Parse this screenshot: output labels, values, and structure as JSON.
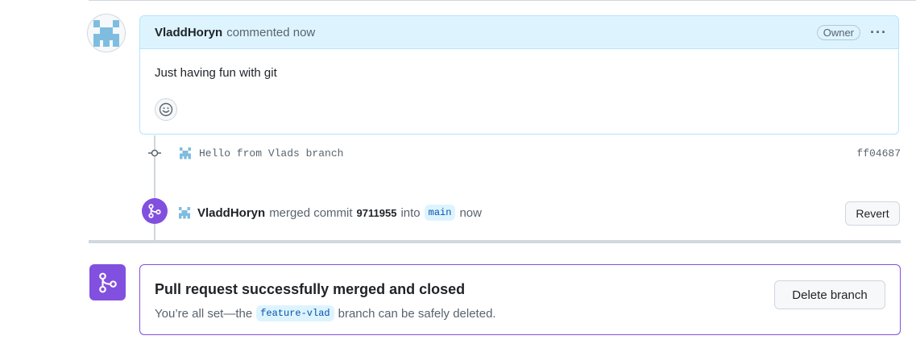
{
  "comment": {
    "author": "VladdHoryn",
    "action": "commented now",
    "role_badge": "Owner",
    "body": "Just having fun with git"
  },
  "commit": {
    "message": "Hello from Vlads branch",
    "sha": "ff04687"
  },
  "merge_event": {
    "author": "VladdHoryn",
    "action": "merged commit",
    "sha": "9711955",
    "into": "into",
    "branch": "main",
    "time": "now",
    "revert_label": "Revert"
  },
  "merge_status": {
    "title": "Pull request successfully merged and closed",
    "sub_prefix": "You’re all set—the",
    "branch": "feature-vlad",
    "sub_suffix": "branch can be safely deleted.",
    "delete_label": "Delete branch"
  },
  "colors": {
    "merged_purple": "#8250df",
    "comment_header_bg": "#ddf4ff",
    "identicon": "#7fbde0"
  },
  "icons": [
    "identicon-avatar",
    "smiley-icon",
    "git-commit-icon",
    "git-merge-icon",
    "kebab-menu-icon"
  ]
}
